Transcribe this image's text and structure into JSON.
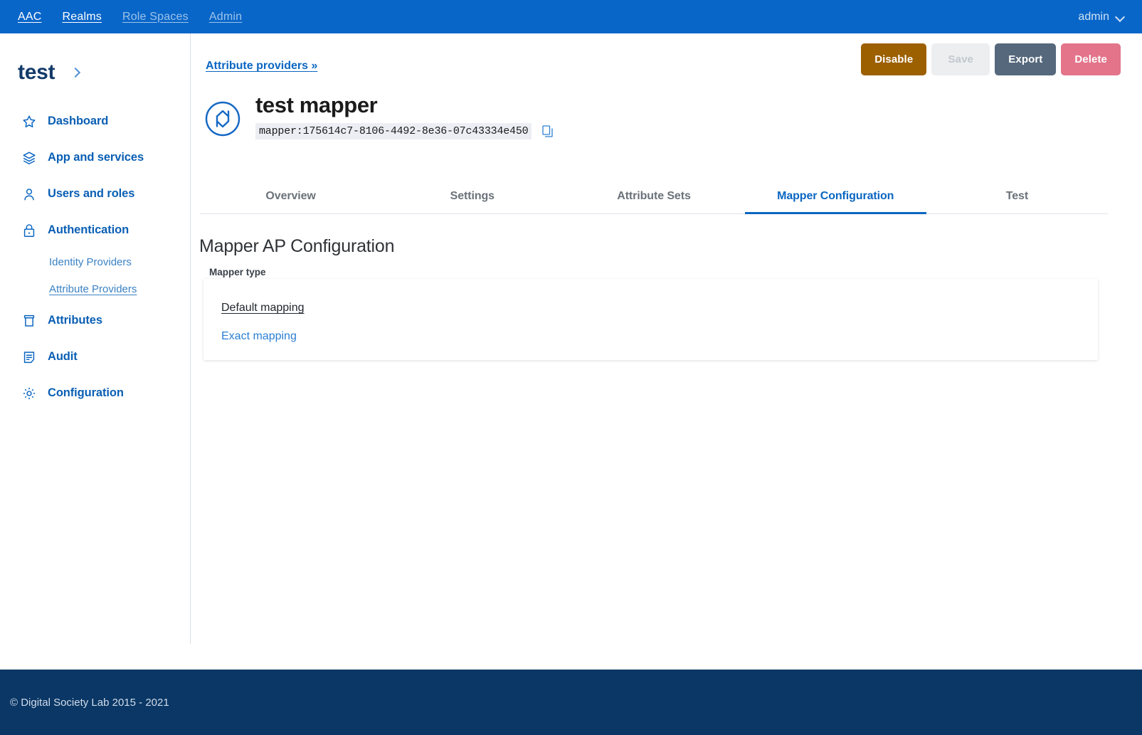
{
  "topnav": {
    "links": [
      {
        "label": "AAC",
        "dim": false
      },
      {
        "label": "Realms",
        "dim": false
      },
      {
        "label": "Role Spaces",
        "dim": true
      },
      {
        "label": "Admin",
        "dim": true
      }
    ],
    "user": "admin",
    "user_caret_icon": "chevron-down-icon"
  },
  "sidebar": {
    "realm": "test",
    "realm_expand_icon": "chevron-right-icon",
    "items": [
      {
        "label": "Dashboard",
        "icon": "star-icon"
      },
      {
        "label": "App and services",
        "icon": "layers-icon"
      },
      {
        "label": "Users and roles",
        "icon": "user-icon"
      },
      {
        "label": "Authentication",
        "icon": "lock-icon"
      }
    ],
    "sub_items": [
      {
        "label": "Identity Providers",
        "active": false
      },
      {
        "label": "Attribute Providers",
        "active": true
      }
    ],
    "items_after": [
      {
        "label": "Attributes",
        "icon": "archive-icon"
      },
      {
        "label": "Audit",
        "icon": "document-lines-icon"
      },
      {
        "label": "Configuration",
        "icon": "gear-icon"
      }
    ]
  },
  "header": {
    "breadcrumb": "Attribute providers »",
    "title": "test mapper",
    "entity_icon": "sync-arrows-circle-icon",
    "id": "mapper:175614c7-8106-4492-8e36-07c43334e450",
    "copy_icon": "copy-icon"
  },
  "actions": {
    "disable": "Disable",
    "save": "Save",
    "export": "Export",
    "delete": "Delete"
  },
  "tabs": [
    {
      "label": "Overview",
      "active": false
    },
    {
      "label": "Settings",
      "active": false
    },
    {
      "label": "Attribute Sets",
      "active": false
    },
    {
      "label": "Mapper Configuration",
      "active": true
    },
    {
      "label": "Test",
      "active": false
    }
  ],
  "content": {
    "section_title": "Mapper AP Configuration",
    "field_label": "Mapper type",
    "option_selected": "Default mapping",
    "option_other": "Exact mapping"
  },
  "footer": {
    "copyright": "© Digital Society Lab 2015 - 2021"
  },
  "colors": {
    "brand_blue": "#0966c9",
    "footer_navy": "#0a3765",
    "link_blue": "#0a66c2",
    "disable_amber": "#9c6000",
    "export_slate": "#55687c",
    "delete_pink": "#e3748a",
    "save_disabled": "#eceef0"
  }
}
